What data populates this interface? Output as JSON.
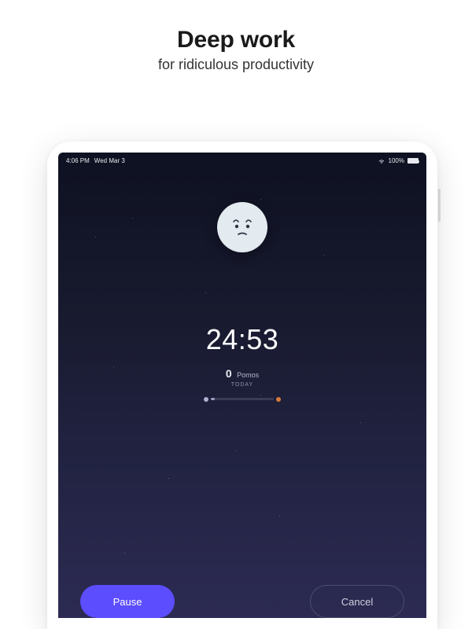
{
  "hero": {
    "title": "Deep work",
    "subtitle": "for ridiculous productivity"
  },
  "statusBar": {
    "time": "4:06 PM",
    "date": "Wed Mar 3",
    "batteryPercent": "100%"
  },
  "timer": {
    "display": "24:53"
  },
  "pomos": {
    "count": "0",
    "label": "Pomos",
    "today": "TODAY"
  },
  "buttons": {
    "pause": "Pause",
    "cancel": "Cancel"
  },
  "colors": {
    "accent": "#5c4dff",
    "progressEnd": "#d97b3c"
  }
}
